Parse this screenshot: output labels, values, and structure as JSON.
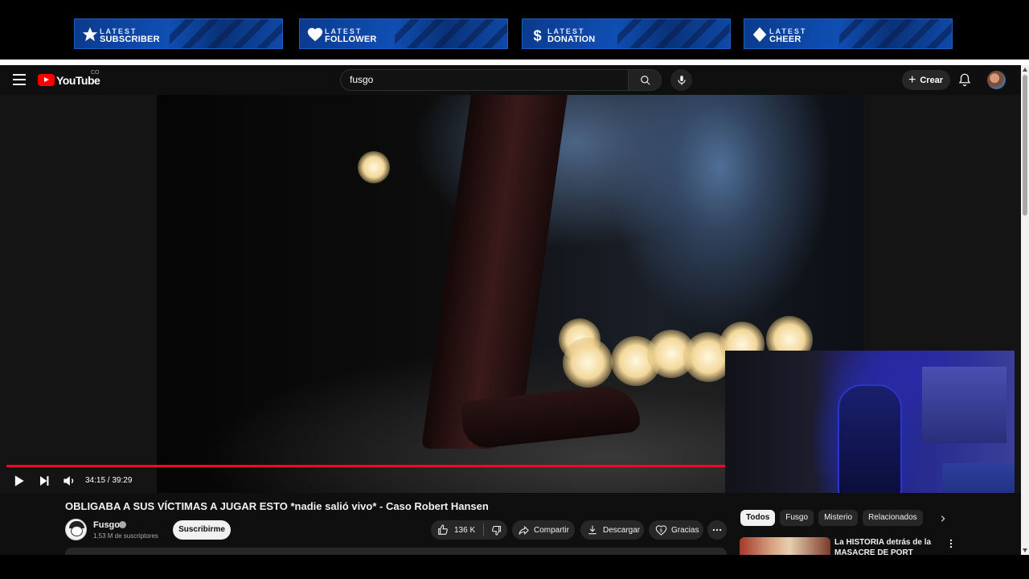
{
  "overlay": {
    "banners": [
      {
        "top": "LATEST",
        "bottom": "SUBSCRIBER",
        "icon": "star-icon"
      },
      {
        "top": "LATEST",
        "bottom": "FOLLOWER",
        "icon": "heart-icon"
      },
      {
        "top": "LATEST",
        "bottom": "DONATION",
        "icon": "dollar-icon"
      },
      {
        "top": "LATEST",
        "bottom": "CHEER",
        "icon": "diamond-icon"
      }
    ]
  },
  "header": {
    "logo_text": "YouTube",
    "country_code": "CO",
    "search_value": "fusgo",
    "create_label": "Crear"
  },
  "player": {
    "timecode": "34:15 / 39:29",
    "progress_fraction": 0.867
  },
  "video": {
    "title": "OBLIGABA A SUS VÍCTIMAS A JUGAR ESTO *nadie salió vivo* - Caso Robert Hansen",
    "channel_name": "Fusgo",
    "subscribers": "1,53 M de suscriptores",
    "subscribe_label": "Suscribirme",
    "likes": "136 K",
    "share_label": "Compartir",
    "download_label": "Descargar",
    "thanks_label": "Gracias"
  },
  "sidebar": {
    "chips": [
      "Todos",
      "Fusgo",
      "Misterio",
      "Relacionados"
    ],
    "rec_title": "La HISTORIA detrás de la MASACRE DE PORT ARTHUR -"
  },
  "colors": {
    "accent_red": "#ff0033",
    "banner_blue": "#0f4fb3",
    "background": "#0f0f0f"
  }
}
